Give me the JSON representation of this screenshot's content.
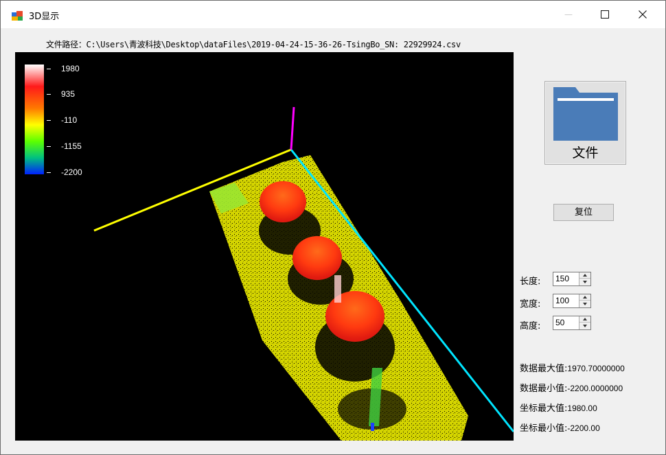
{
  "window": {
    "title": "3D显示",
    "minimize_glyph": "—",
    "maximize_glyph": "☐",
    "close_glyph": "✕"
  },
  "file_path": {
    "label": "文件路径：",
    "value": "C:\\Users\\青波科技\\Desktop\\dataFiles\\2019-04-24-15-36-26-TsingBo_SN: 22929924.csv"
  },
  "legend": {
    "labels": [
      "1980",
      "935",
      "-110",
      "-1155",
      "-2200"
    ]
  },
  "file_button": {
    "label": "文件",
    "icon": "folder-icon"
  },
  "reset_button": {
    "label": "复位"
  },
  "dimensions": {
    "length": {
      "label": "长度:",
      "value": "150"
    },
    "width": {
      "label": "宽度:",
      "value": "100"
    },
    "height": {
      "label": "高度:",
      "value": "50"
    }
  },
  "stats": {
    "data_max": {
      "label": "数据最大值:",
      "value": "1970.70000000"
    },
    "data_min": {
      "label": "数据最小值:",
      "value": "-2200.0000000"
    },
    "axis_max": {
      "label": "坐标最大值:",
      "value": "1980.00"
    },
    "axis_min": {
      "label": "坐标最小值:",
      "value": "-2200.00"
    }
  },
  "colors": {
    "axis_x": "#ffff00",
    "axis_y": "#00e5ff",
    "axis_z": "#ff00ff",
    "folder": "#4a7cb8"
  }
}
